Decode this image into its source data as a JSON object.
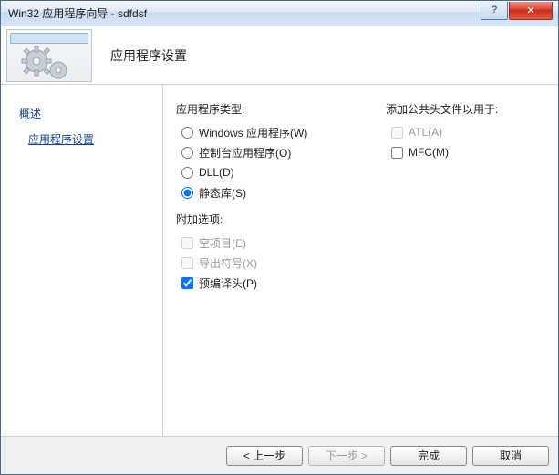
{
  "window": {
    "title": "Win32 应用程序向导 - sdfdsf",
    "help_symbol": "?",
    "close_symbol": "✕"
  },
  "header": {
    "title": "应用程序设置"
  },
  "nav": {
    "items": [
      {
        "label": "概述"
      },
      {
        "label": "应用程序设置"
      }
    ]
  },
  "content": {
    "app_type_label": "应用程序类型:",
    "app_type": {
      "windows": "Windows 应用程序(W)",
      "console": "控制台应用程序(O)",
      "dll": "DLL(D)",
      "static": "静态库(S)",
      "selected": "static"
    },
    "additional_label": "附加选项:",
    "additional": {
      "empty": "空项目(E)",
      "export": "导出符号(X)",
      "precompiled": "预编译头(P)"
    },
    "common_headers_label": "添加公共头文件以用于:",
    "common_headers": {
      "atl": "ATL(A)",
      "mfc": "MFC(M)"
    }
  },
  "footer": {
    "prev": "< 上一步",
    "next": "下一步 >",
    "finish": "完成",
    "cancel": "取消"
  }
}
